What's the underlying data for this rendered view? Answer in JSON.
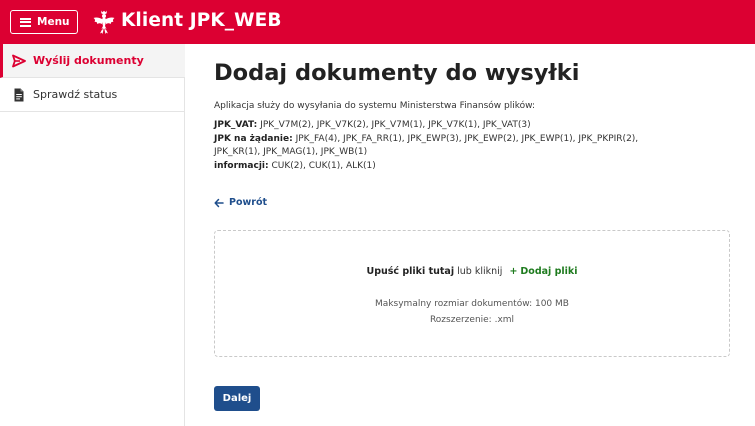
{
  "header": {
    "menu_label": "Menu",
    "app_title": "Klient JPK_WEB",
    "accent_color": "#dc0032",
    "menu_icon": "hamburger-icon",
    "logo_icon": "polish-eagle-emblem"
  },
  "sidebar": {
    "items": [
      {
        "label": "Wyślij dokumenty",
        "icon": "send-icon",
        "active": true
      },
      {
        "label": "Sprawdź status",
        "icon": "document-icon",
        "active": false
      }
    ]
  },
  "main": {
    "title": "Dodaj dokumenty do wysyłki",
    "intro": "Aplikacja służy do wysyłania do systemu Ministerstwa Finansów plików:",
    "groups": [
      {
        "label": "JPK_VAT:",
        "items": "JPK_V7M(2), JPK_V7K(2), JPK_V7M(1), JPK_V7K(1), JPK_VAT(3)"
      },
      {
        "label": "JPK na żądanie:",
        "items": "JPK_FA(4), JPK_FA_RR(1), JPK_EWP(3), JPK_EWP(2), JPK_EWP(1), JPK_PKPIR(2), JPK_KR(1), JPK_MAG(1), JPK_WB(1)"
      },
      {
        "label": "informacji:",
        "items": "CUK(2), CUK(1), ALK(1)"
      }
    ],
    "back_label": "Powrót",
    "dropzone": {
      "drop_strong": "Upuść pliki tutaj",
      "or_click": "lub kliknij",
      "add_files": "Dodaj pliki",
      "max_size": "Maksymalny rozmiar dokumentów: 100 MB",
      "extension": "Rozszerzenie: .xml"
    },
    "next_label": "Dalej",
    "link_color": "#1f4e8c",
    "add_color": "#1e7b1e"
  }
}
